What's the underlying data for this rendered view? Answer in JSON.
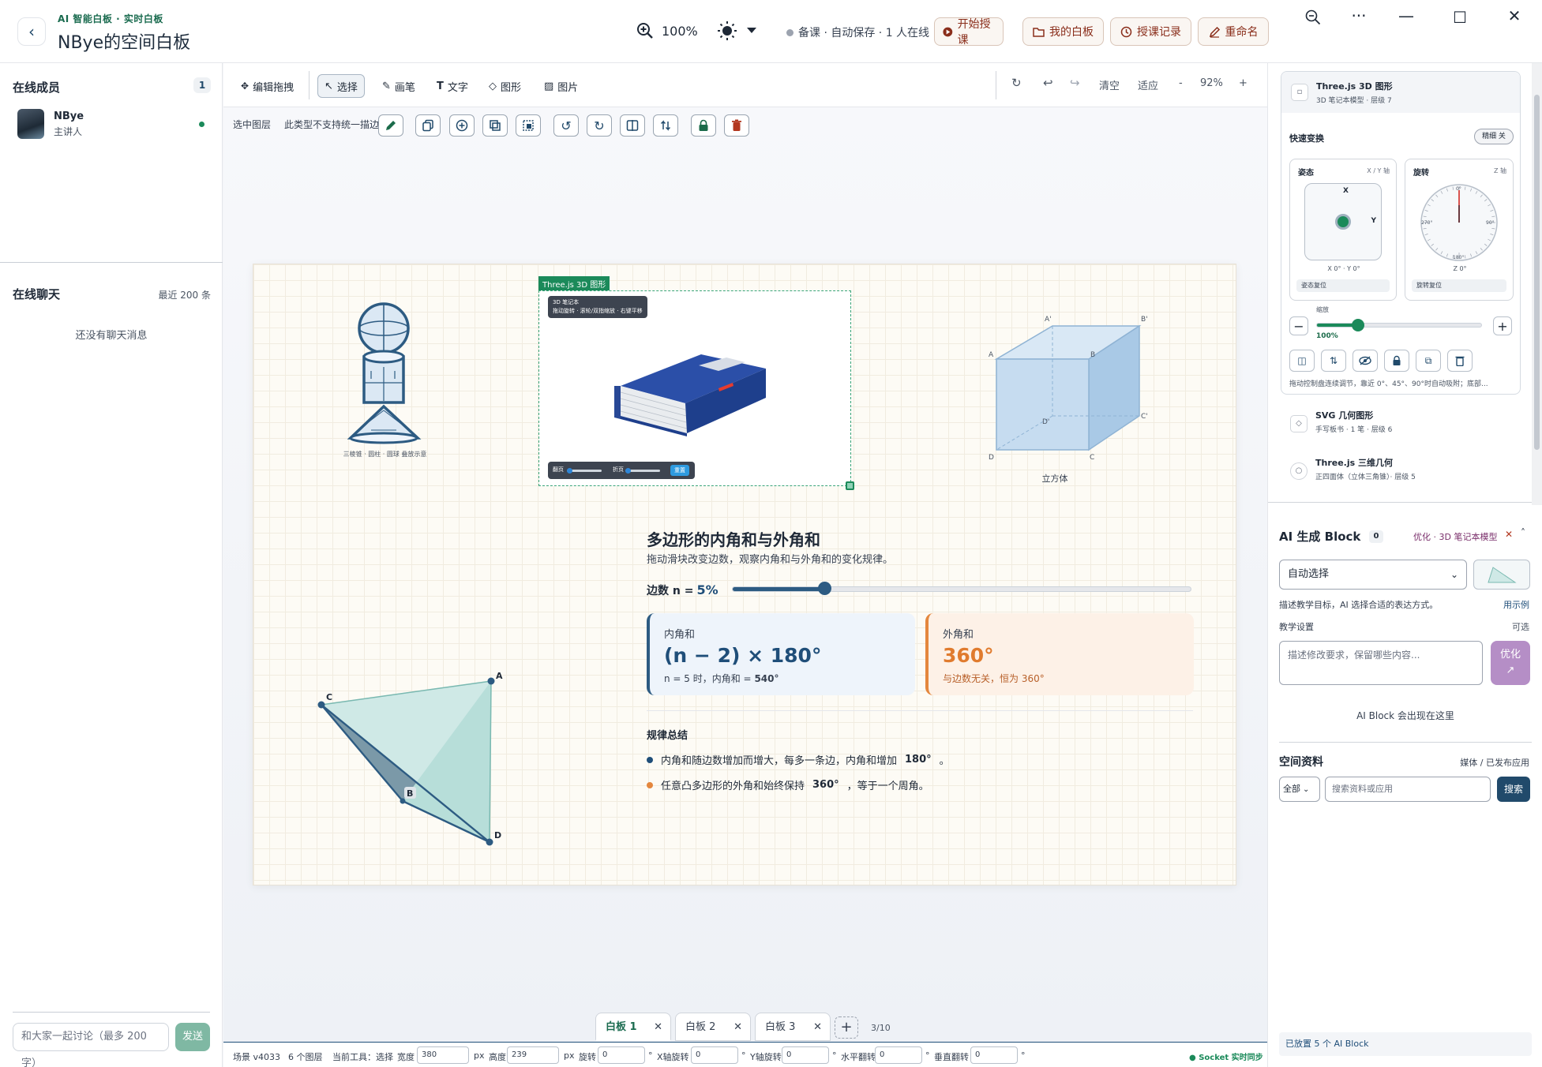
{
  "header": {
    "subtitle": "AI 智能白板 · 实时白板",
    "title": "NBye的空间白板",
    "zoom": "100%",
    "status": "备课 · 自动保存 · 1 人在线",
    "buttons": [
      "开始授课",
      "我的白板",
      "授课记录",
      "重命名"
    ]
  },
  "members": {
    "title": "在线成员",
    "count": "1",
    "list": [
      {
        "name": "NBye",
        "role": "主讲人"
      }
    ]
  },
  "chat": {
    "title": "在线聊天",
    "meta": "最近 200 条",
    "empty": "还没有聊天消息",
    "placeholder": "和大家一起讨论（最多 200 字）",
    "send": "发送"
  },
  "toolbar": {
    "tools": [
      "编辑拖拽",
      "选择",
      "画笔",
      "文字",
      "图形",
      "图片"
    ],
    "right": [
      "清空",
      "适应",
      "-",
      "92%",
      "+"
    ]
  },
  "subbar": {
    "label": "选中图层",
    "note": "此类型不支持统一描边"
  },
  "board": {
    "sel_label": "Three.js 3D 图形",
    "book_tag_1": "3D 笔记本",
    "book_tag_2": "拖动旋转 · 滚轮/双指缩放 · 右键平移",
    "book_ctrl": [
      "翻页",
      "折页",
      "重置"
    ],
    "cylinder_caption": "三棱锥 · 圆柱 · 圆球 叠放示意",
    "cube_caption": "立方体",
    "cube_vertices": [
      "A'",
      "B'",
      "A",
      "B",
      "D'",
      "C'",
      "D",
      "C"
    ],
    "tri_vertices": [
      "A",
      "B",
      "C",
      "D"
    ],
    "poly": {
      "title": "多边形的内角和与外角和",
      "sub": "拖动滑块改变边数，观察内角和与外角和的变化规律。",
      "edge_label": "边数 n =",
      "edge_value": "5%",
      "slider_fraction": 0.2,
      "inner_label": "内角和",
      "inner_formula": "(n − 2) × 180°",
      "inner_note_pre": "n = 5 时，内角和 =",
      "inner_note_val": "540°",
      "outer_label": "外角和",
      "outer_value": "360°",
      "outer_note": "与边数无关，恒为 360°",
      "summary_title": "规律总结",
      "summary_1_pre": "内角和随边数增加而增大，每多一条边，内角和增加",
      "summary_1_val": "180°",
      "summary_1_post": "。",
      "summary_2_pre": "任意凸多边形的外角和始终保持",
      "summary_2_val": "360°",
      "summary_2_post": "，等于一个周角。"
    }
  },
  "tabs": {
    "items": [
      "白板 1",
      "白板 2",
      "白板 3"
    ],
    "count": "3/10"
  },
  "status": {
    "scene": "场景 v4033",
    "layers": "6 个图层",
    "tool": "当前工具：选择",
    "width_label": "宽度",
    "width": "380",
    "px": "px",
    "height_label": "高度",
    "height": "239",
    "rot_label": "旋转",
    "rot": "0",
    "xrot_label": "X轴旋转",
    "xrot": "0",
    "yrot_label": "Y轴旋转",
    "yrot": "0",
    "hflip_label": "水平翻转",
    "hflip": "0",
    "vflip_label": "垂直翻转",
    "vflip": "0",
    "deg": "°",
    "sync": "● Socket 实时同步"
  },
  "right": {
    "layer_active_title": "Three.js 3D 图形",
    "layer_active_sub": "3D 笔记本模型 · 层级 7",
    "quick": "快速变换",
    "fine": "精细 关",
    "pose": "姿态",
    "pose_axis": "X / Y 轴",
    "pose_x": "X",
    "pose_y": "Y",
    "pose_val": "X 0° · Y 0°",
    "pose_reset": "姿态复位",
    "rot": "旋转",
    "rot_axis": "Z 轴",
    "dial_0": "0°",
    "dial_90": "90°",
    "dial_180": "180°",
    "dial_270": "270°",
    "rot_val": "Z 0°",
    "rot_reset": "旋转复位",
    "scale_label": "缩放",
    "scale_val": "100%",
    "scale_fraction": 0.25,
    "hint": "拖动控制盘连续调节，靠近 0°、45°、90°时自动吸附；底部...",
    "layers": [
      {
        "title": "SVG 几何图形",
        "sub": "手写板书 · 1 笔 · 层级 6"
      },
      {
        "title": "Three.js 三维几何",
        "sub": "正四面体（立体三角锥）· 层级 5"
      }
    ],
    "ai_title": "AI 生成 Block",
    "ai_count": "0",
    "ai_opt_tag": "优化 · 3D 笔记本模型",
    "ai_select": "自动选择",
    "ai_desc": "描述教学目标，AI 选择合适的表达方式。",
    "ai_example": "用示例",
    "ai_settings": "教学设置",
    "ai_optional": "可选",
    "ai_placeholder": "描述修改要求，保留哪些内容...",
    "ai_opt_btn": "优化",
    "ai_empty": "AI Block 会出现在这里",
    "space_title": "空间资料",
    "space_meta": "媒体 / 已发布应用",
    "space_filter": "全部",
    "space_placeholder": "搜索资料或应用",
    "space_search": "搜索",
    "footer": "已放置 5 个 AI Block"
  }
}
